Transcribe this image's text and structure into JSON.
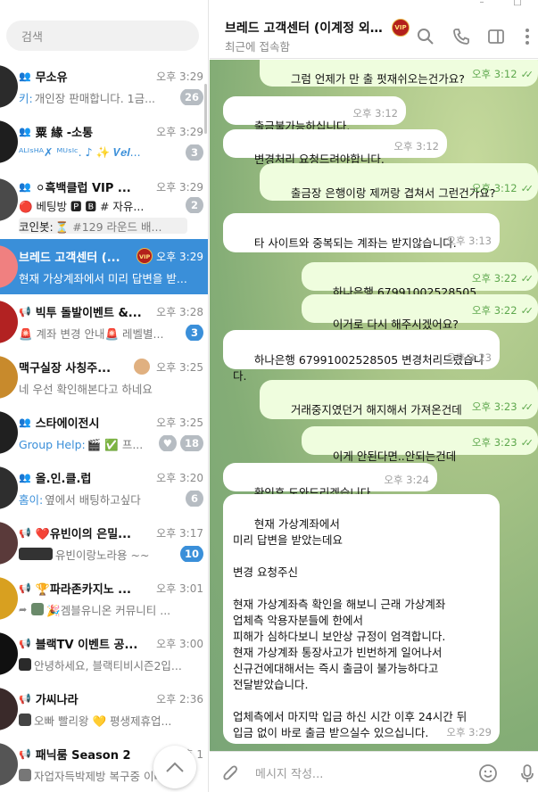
{
  "search": {
    "placeholder": "검색"
  },
  "chats": [
    {
      "name": "무소유",
      "kind": "group",
      "time": "오후 3:29",
      "sender": "키:",
      "preview": "개인장 판매합니다. 1금...",
      "badge": "26",
      "badge_color": "gray",
      "avatar_color": "#2b2b2b"
    },
    {
      "name": "粟 緣 -소통",
      "kind": "group",
      "time": "오후 3:29",
      "sender": "",
      "preview": "ᴬᴸᴵˢᴴᴬ✗ ᴹᵁˢᴵᶜ. ♪ ✨ 𝑽𝒆𝒍...",
      "badge": "3",
      "badge_color": "gray",
      "avatar_color": "#1e1e1e"
    },
    {
      "name": "⚪흑백클럽 VIP ...",
      "kind": "group",
      "time": "오후 3:29",
      "sender": "코인봇:",
      "preview": "⏳ #129 라운드 배...",
      "pre_line": "🔴 베팅방 🅿 🅱   # 자유...",
      "badge": "2",
      "badge_color": "gray",
      "avatar_color": "#4a4a4a"
    },
    {
      "name": "브레드 고객센터 (...",
      "kind": "user",
      "time": "오후 3:29",
      "sender": "",
      "preview": "현재 가상계좌에서 미리 답변을 받...",
      "badge": "",
      "badge_color": "",
      "avatar_color": "#f08080",
      "vip": "VIP",
      "active": true
    },
    {
      "name": "빅투 돌발이벤트 &...",
      "kind": "channel",
      "time": "오후 3:28",
      "sender": "",
      "preview": "🚨 계좌 변경 안내🚨  레벨별...",
      "badge": "3",
      "badge_color": "blue",
      "avatar_color": "#b22222"
    },
    {
      "name": "맥구실장 사칭주...",
      "kind": "user",
      "time": "오후 3:25",
      "sender": "",
      "preview": "네 우선 확인해본다고 하네요",
      "badge": "",
      "badge_color": "",
      "avatar_color": "#c88a2c"
    },
    {
      "name": "스타에이전시",
      "kind": "group",
      "time": "오후 3:25",
      "sender": "Group Help:",
      "preview": "🎬 ✅ 프...",
      "badge": "18",
      "badge_color": "gray",
      "avatar_color": "#202020",
      "muted": true
    },
    {
      "name": "올.인.클.럽",
      "kind": "group",
      "time": "오후 3:20",
      "sender": "홈이:",
      "preview": "옆에서 배팅하고싶다",
      "badge": "6",
      "badge_color": "gray",
      "avatar_color": "#2e2e2e"
    },
    {
      "name": "❤️유빈이의 은밀...",
      "kind": "channel",
      "time": "오후 3:17",
      "sender": "",
      "preview": "유빈이랑노라용 ~~",
      "badge": "10",
      "badge_color": "blue",
      "avatar_color": "#5a3a3a"
    },
    {
      "name": "🏆파라존카지노 ...",
      "kind": "channel",
      "time": "오후 3:01",
      "sender": "",
      "preview": "🎉겜블유니온 커뮤니티 ...",
      "badge": "",
      "badge_color": "",
      "avatar_color": "#d8a020"
    },
    {
      "name": "블랙TV 이벤트 공...",
      "kind": "channel",
      "time": "오후 3:00",
      "sender": "",
      "preview": "안녕하세요, 블랙티비시즌2입...",
      "badge": "",
      "badge_color": "",
      "avatar_color": "#101010"
    },
    {
      "name": "가씨나라",
      "kind": "channel",
      "time": "오후 2:36",
      "sender": "",
      "preview": "오빠 빨리왕 💛 평생제휴업...",
      "badge": "",
      "badge_color": "",
      "avatar_color": "#3a2a2a"
    },
    {
      "name": "패닉룸 Season 2",
      "kind": "channel",
      "time": "오후 1",
      "sender": "",
      "preview": "자업자득박제방 복구중 이라...",
      "badge": "",
      "badge_color": "",
      "avatar_color": "#555555"
    }
  ],
  "header": {
    "title": "브레드 고객센터 (이계정 외...",
    "vip": "VIP",
    "status": "최근에 접속함"
  },
  "messages": [
    {
      "dir": "out",
      "text": "그럼 언제가 만 출 펏재쉬오는건가요?",
      "time": "오후 3:12",
      "read": "✓✓"
    },
    {
      "dir": "in",
      "text": "출금불가능하십니다.",
      "time": "오후 3:12",
      "read": ""
    },
    {
      "dir": "in",
      "text": "변경처리 요청드려야합니다.",
      "time": "오후 3:12",
      "read": ""
    },
    {
      "dir": "out",
      "text": "출금장 은행이랑 제꺼랑 겹쳐서 그런건가요?",
      "time": "오후 3:12",
      "read": "✓✓"
    },
    {
      "dir": "in",
      "text": "타 사이트와 중복되는 계좌는 받지않습니다.",
      "time": "오후 3:13",
      "read": ""
    },
    {
      "dir": "out",
      "text": "하나은행 67991002528505",
      "time": "오후 3:22",
      "read": "✓✓"
    },
    {
      "dir": "out",
      "text": "이거로 다시 해주시겠어요?",
      "time": "오후 3:22",
      "read": "✓✓"
    },
    {
      "dir": "in",
      "text": "하나은행 67991002528505 변경처리드렸습니다.",
      "time": "오후 3:23",
      "read": ""
    },
    {
      "dir": "out",
      "text": "거래중지였던거 해지해서 가져온건데",
      "time": "오후 3:23",
      "read": "✓✓"
    },
    {
      "dir": "out",
      "text": "이게 안된다면..안되는건데",
      "time": "오후 3:23",
      "read": "✓✓"
    },
    {
      "dir": "in",
      "text": "확인후 도와드리겠습니다.",
      "time": "오후 3:24",
      "read": ""
    },
    {
      "dir": "in",
      "text": "현재 가상계좌에서\n미리 답변을 받았는데요\n\n변경 요청주신\n\n현재 가상계좌측 확인을 해보니 근래 가상계좌\n업체측 악용자분들에 한에서\n피해가 심하다보니 보안상 규정이 엄격합니다.\n현재 가상계좌 통장사고가 빈번하게 일어나서\n신규건에대해서는 즉시 출금이 불가능하다고\n전달받았습니다.\n\n업체측에서 마지막 입금 하신 시간 이후 24시간 뒤\n입금 없이 바로 출금 받으실수 있으십니다.",
      "time": "오후 3:29",
      "read": ""
    }
  ],
  "composer": {
    "placeholder": "메시지 작성..."
  },
  "colors": {
    "accent": "#3a8fd9",
    "outgoing_bubble": "#effdde",
    "incoming_bubble": "#ffffff",
    "wallpaper": "#8fb37a"
  }
}
